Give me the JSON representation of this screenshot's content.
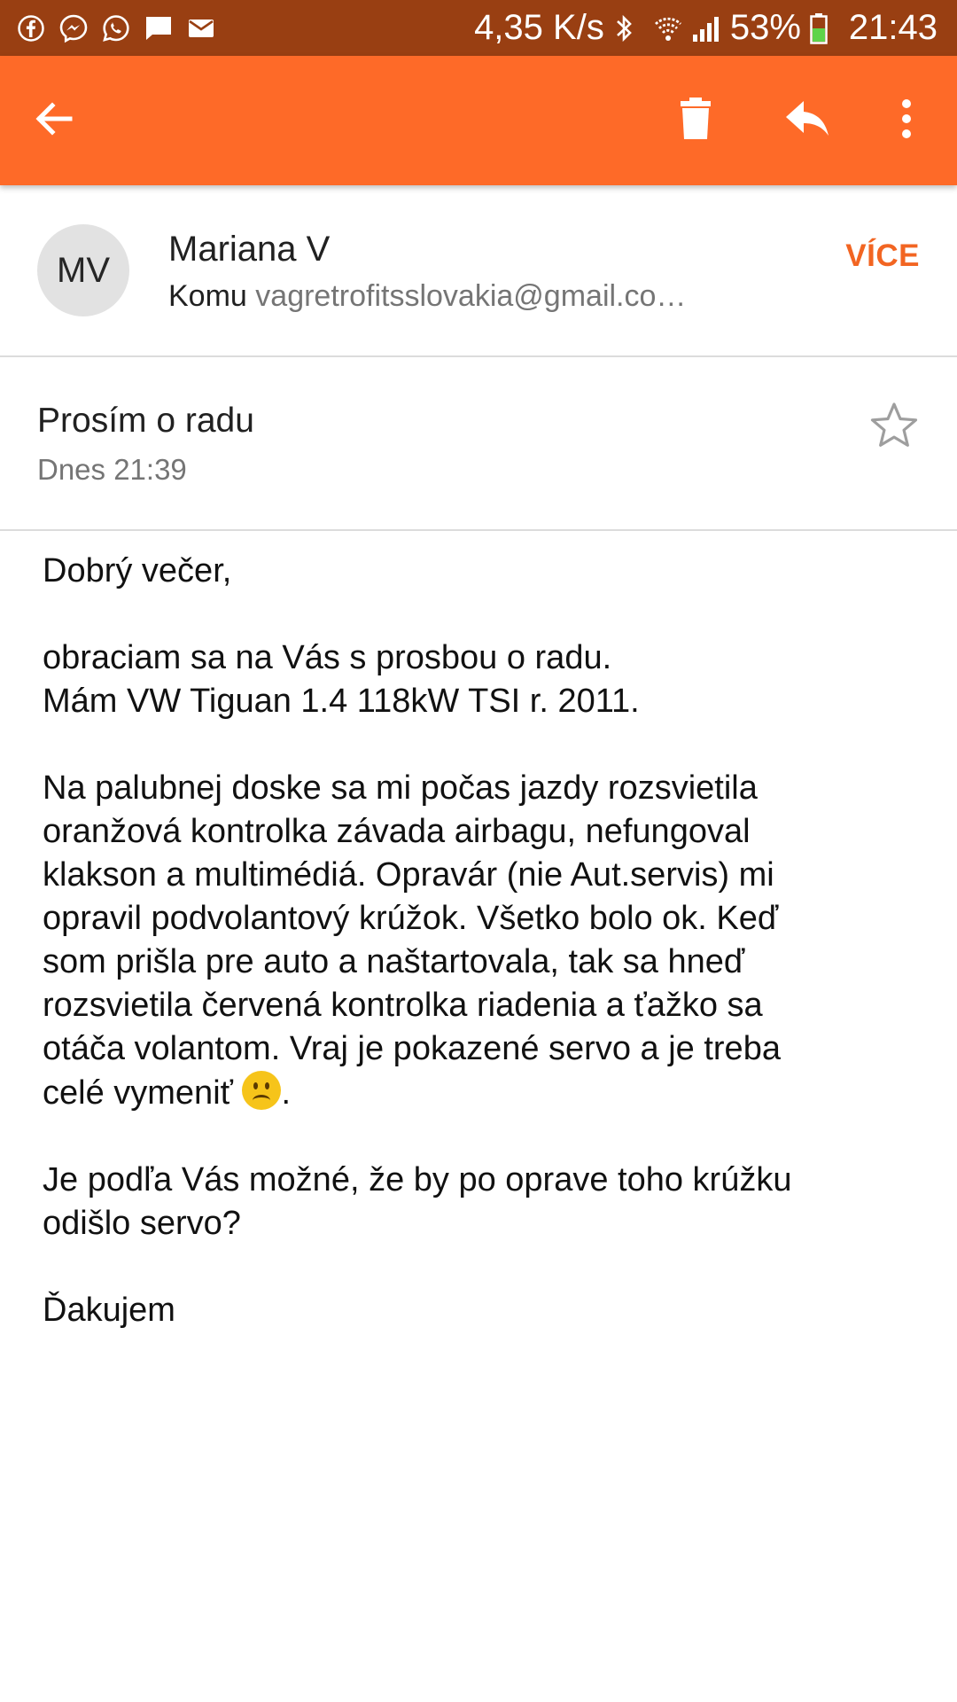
{
  "status_bar": {
    "icons": [
      "facebook-icon",
      "messenger-icon",
      "whatsapp-icon",
      "message-icon",
      "mail-icon"
    ],
    "network_speed": "4,35 K/s",
    "battery": "53%",
    "time": "21:43",
    "bg_color": "#993f12"
  },
  "app_bar": {
    "bg_color": "#fe6a28",
    "icons": [
      "back-arrow-icon",
      "trash-icon",
      "reply-icon",
      "more-vert-icon"
    ]
  },
  "sender": {
    "initials": "MV",
    "name": "Mariana V",
    "to_label": "Komu",
    "to_email": "vagretrofitsslovakia@gmail.co…",
    "more_label": "VÍCE"
  },
  "message": {
    "subject": "Prosím o radu",
    "date": "Dnes 21:39",
    "body": {
      "greeting": "Dobrý večer,",
      "p1": [
        "obraciam sa na Vás s prosbou o radu.",
        "Mám VW Tiguan 1.4 118kW TSI r. 2011."
      ],
      "p2": [
        "Na palubnej doske sa mi počas jazdy rozsvietila",
        "oranžová kontrolka závada airbagu, nefungoval",
        "klakson a multimédiá. Opravár (nie Aut.servis) mi",
        "opravil podvolantový krúžok. Všetko bolo ok. Keď",
        "som prišla pre auto a naštartovala, tak sa hneď",
        "rozsvietila červená kontrolka riadenia a ťažko sa",
        "otáča volantom. Vraj je pokazené servo a je treba",
        "celé vymeniť"
      ],
      "p2_end": ".",
      "p3": [
        "Je podľa Vás možné, že by po oprave toho krúžku",
        "odišlo servo?"
      ],
      "closing": "Ďakujem"
    }
  }
}
